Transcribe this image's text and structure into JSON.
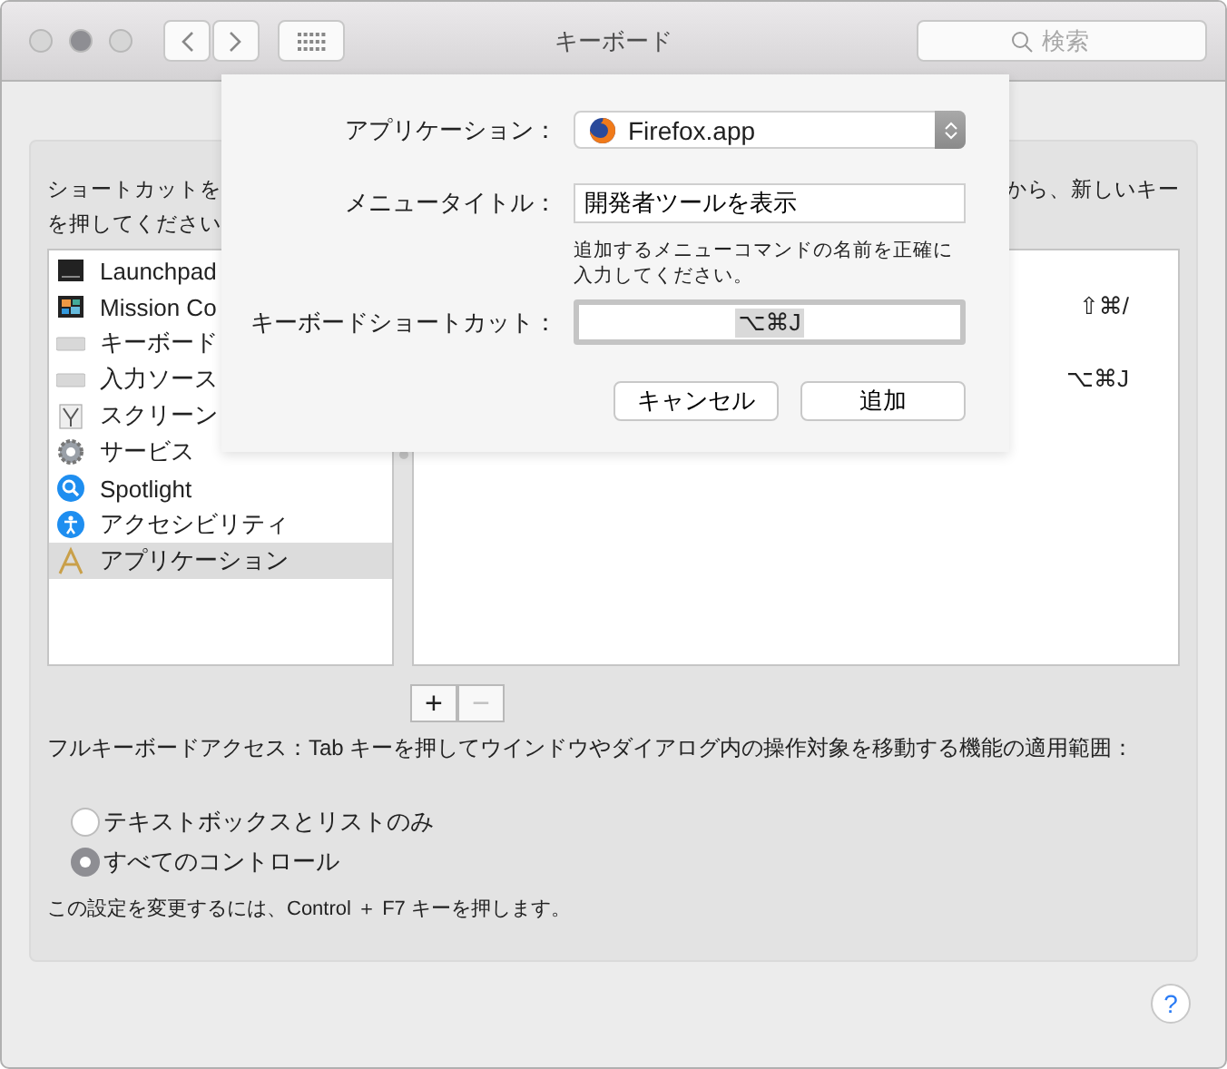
{
  "window": {
    "title": "キーボード",
    "search": {
      "placeholder": "検索"
    }
  },
  "intro": {
    "left_lines": [
      "ショートカットを",
      "を押してください"
    ],
    "right": "から、新しいキー"
  },
  "categories": [
    {
      "kind": "launchpad",
      "label": "Launchpad",
      "selected": false
    },
    {
      "kind": "mission",
      "label": "Mission Co",
      "selected": false
    },
    {
      "kind": "keyboard",
      "label": "キーボード",
      "selected": false
    },
    {
      "kind": "keyboard",
      "label": "入力ソース",
      "selected": false
    },
    {
      "kind": "screenshot",
      "label": "スクリーン",
      "selected": false
    },
    {
      "kind": "services",
      "label": "サービス",
      "selected": false
    },
    {
      "kind": "spotlight",
      "label": "Spotlight",
      "selected": false
    },
    {
      "kind": "accessibility",
      "label": "アクセシビリティ",
      "selected": false
    },
    {
      "kind": "apps",
      "label": "アプリケーション",
      "selected": true
    }
  ],
  "shortcuts": [
    "⇧⌘/",
    "⌥⌘J"
  ],
  "add_remove": {
    "add": "+",
    "remove": "−",
    "remove_disabled": true
  },
  "full_keyboard_access": "フルキーボードアクセス：Tab キーを押してウインドウやダイアログ内の操作対象を移動する機能の適用範囲：",
  "radios": [
    {
      "label": "テキストボックスとリストのみ",
      "selected": false
    },
    {
      "label": "すべてのコントロール",
      "selected": true
    }
  ],
  "note": "この設定を変更するには、Control ＋ F7 キーを押します。",
  "help": "?",
  "sheet": {
    "application_label": "アプリケーション：",
    "application": "Firefox.app",
    "menu_title_label": "メニュータイトル：",
    "menu_title": "開発者ツールを表示",
    "hint": "追加するメニューコマンドの名前を正確に入力してください。",
    "shortcut_label": "キーボードショートカット：",
    "shortcut": "⌥⌘J",
    "cancel": "キャンセル",
    "add": "追加"
  }
}
